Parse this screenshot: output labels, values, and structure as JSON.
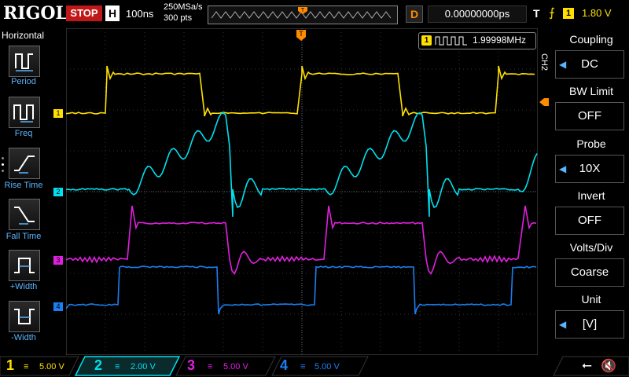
{
  "brand": "RIGOL",
  "run_state": "STOP",
  "horizontal": {
    "tag": "H",
    "timebase": "100ns",
    "sample_rate": "250MSa/s",
    "points": "300 pts"
  },
  "delay": {
    "tag": "D",
    "value": "0.00000000ps"
  },
  "trigger": {
    "tag": "T",
    "source": "1",
    "level": "1.80 V",
    "edge_icon": "rising-edge-icon"
  },
  "frequency_readout": {
    "channel": "1",
    "value": "1.99998MHz"
  },
  "left_panel": {
    "title": "Horizontal",
    "items": [
      {
        "label": "Period"
      },
      {
        "label": "Freq"
      },
      {
        "label": "Rise Time"
      },
      {
        "label": "Fall Time"
      },
      {
        "label": "+Width"
      },
      {
        "label": "-Width"
      }
    ]
  },
  "right_panel": {
    "channel_tag": "CH2",
    "items": [
      {
        "title": "Coupling",
        "value": "DC"
      },
      {
        "title": "BW Limit",
        "value": "OFF"
      },
      {
        "title": "Probe",
        "value": "10X"
      },
      {
        "title": "Invert",
        "value": "OFF"
      },
      {
        "title": "Volts/Div",
        "value": "Coarse"
      },
      {
        "title": "Unit",
        "value": "[V]"
      }
    ]
  },
  "channels": [
    {
      "num": "1",
      "scale": "5.00 V",
      "color": "#ffe000"
    },
    {
      "num": "2",
      "scale": "2.00 V",
      "color": "#00e0f0"
    },
    {
      "num": "3",
      "scale": "5.00 V",
      "color": "#e020e0"
    },
    {
      "num": "4",
      "scale": "5.00 V",
      "color": "#1a7ff0"
    }
  ],
  "markers": {
    "ch1": "1",
    "ch2": "2",
    "ch3": "3",
    "ch4": "4",
    "trigger": "T"
  }
}
